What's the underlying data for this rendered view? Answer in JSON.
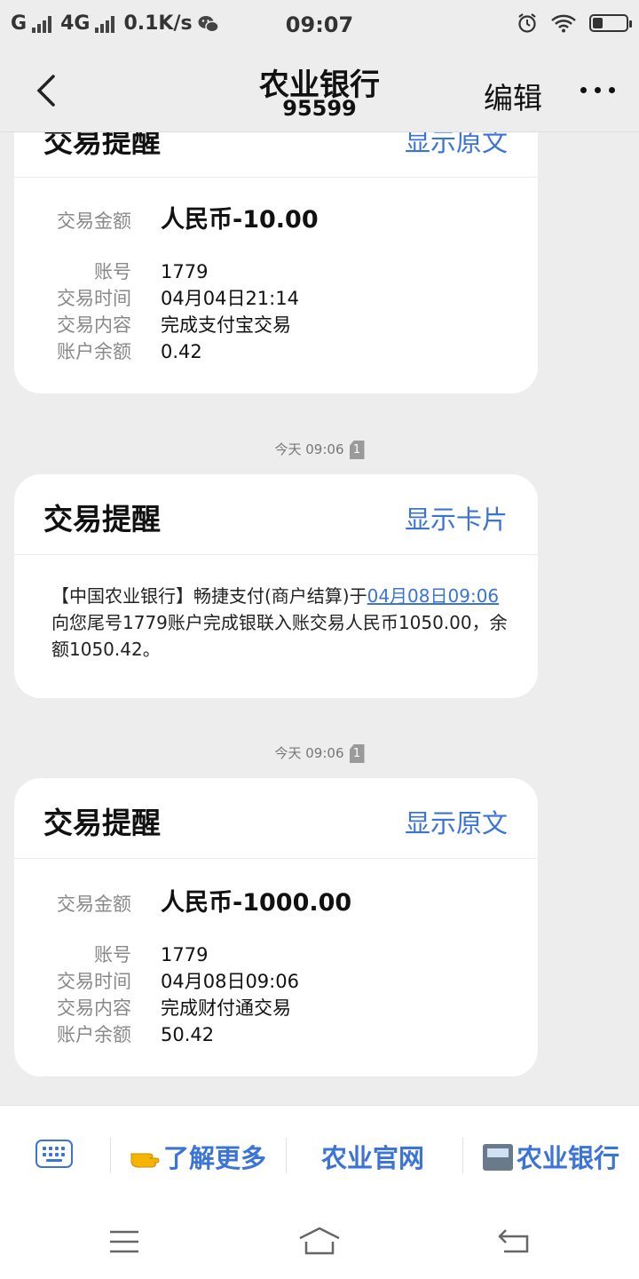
{
  "status_bar": {
    "carrier": "G",
    "network": "4G",
    "speed": "0.1K/s",
    "time": "09:07",
    "battery_level": 0.3
  },
  "header": {
    "title": "农业银行",
    "subtitle": "95599",
    "edit_label": "编辑"
  },
  "messages": [
    {
      "type": "card",
      "title": "交易提醒",
      "action": "显示原文",
      "amount_label": "交易金额",
      "amount": "人民币-10.00",
      "fields": [
        {
          "label": "账号",
          "value": "1779"
        },
        {
          "label": "交易时间",
          "value": "04月04日21:14"
        },
        {
          "label": "交易内容",
          "value": "完成支付宝交易"
        },
        {
          "label": "账户余额",
          "value": "0.42"
        }
      ]
    },
    {
      "type": "text",
      "timestamp": "今天 09:06",
      "sim": "1",
      "title": "交易提醒",
      "action": "显示卡片",
      "text_before": "【中国农业银行】畅捷支付(商户结算)于",
      "text_link": "04月08日09:06",
      "text_after": "向您尾号1779账户完成银联入账交易人民币1050.00，余额1050.42。"
    },
    {
      "type": "card",
      "timestamp": "今天 09:06",
      "sim": "1",
      "title": "交易提醒",
      "action": "显示原文",
      "amount_label": "交易金额",
      "amount": "人民币-1000.00",
      "fields": [
        {
          "label": "账号",
          "value": "1779"
        },
        {
          "label": "交易时间",
          "value": "04月08日09:06"
        },
        {
          "label": "交易内容",
          "value": "完成财付通交易"
        },
        {
          "label": "账户余额",
          "value": "50.42"
        }
      ]
    }
  ],
  "bottom_menu": {
    "item1": "了解更多",
    "item2": "农业官网",
    "item3": "农业银行",
    "finger_icon": "pointing-finger-icon",
    "atm_icon": "atm-icon"
  }
}
